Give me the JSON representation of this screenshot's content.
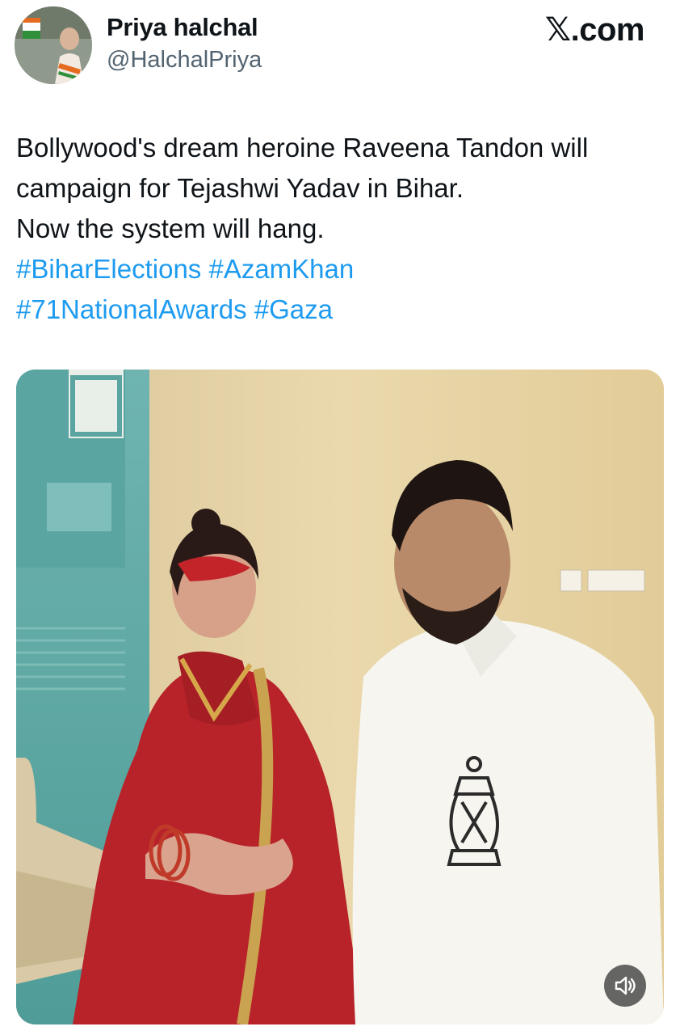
{
  "author": {
    "display_name": "Priya halchal",
    "handle": "@HalchalPriya"
  },
  "brand": {
    "site": "X.com",
    "x_glyph": "𝕏",
    "suffix": ".com"
  },
  "tweet": {
    "lines": [
      "Bollywood's dream heroine Raveena Tandon will",
      "campaign for Tejashwi Yadav in Bihar.",
      "Now the system will hang."
    ],
    "hashtags_line1": [
      "#BiharElections",
      "#AzamKhan"
    ],
    "hashtags_line2": [
      "#71NationalAwards",
      "#Gaza"
    ]
  },
  "media": {
    "type": "video",
    "mute_icon": "speaker-muted-icon"
  },
  "colors": {
    "link": "#1d9bf0",
    "secondary_text": "#536471",
    "primary_text": "#0f1419"
  }
}
